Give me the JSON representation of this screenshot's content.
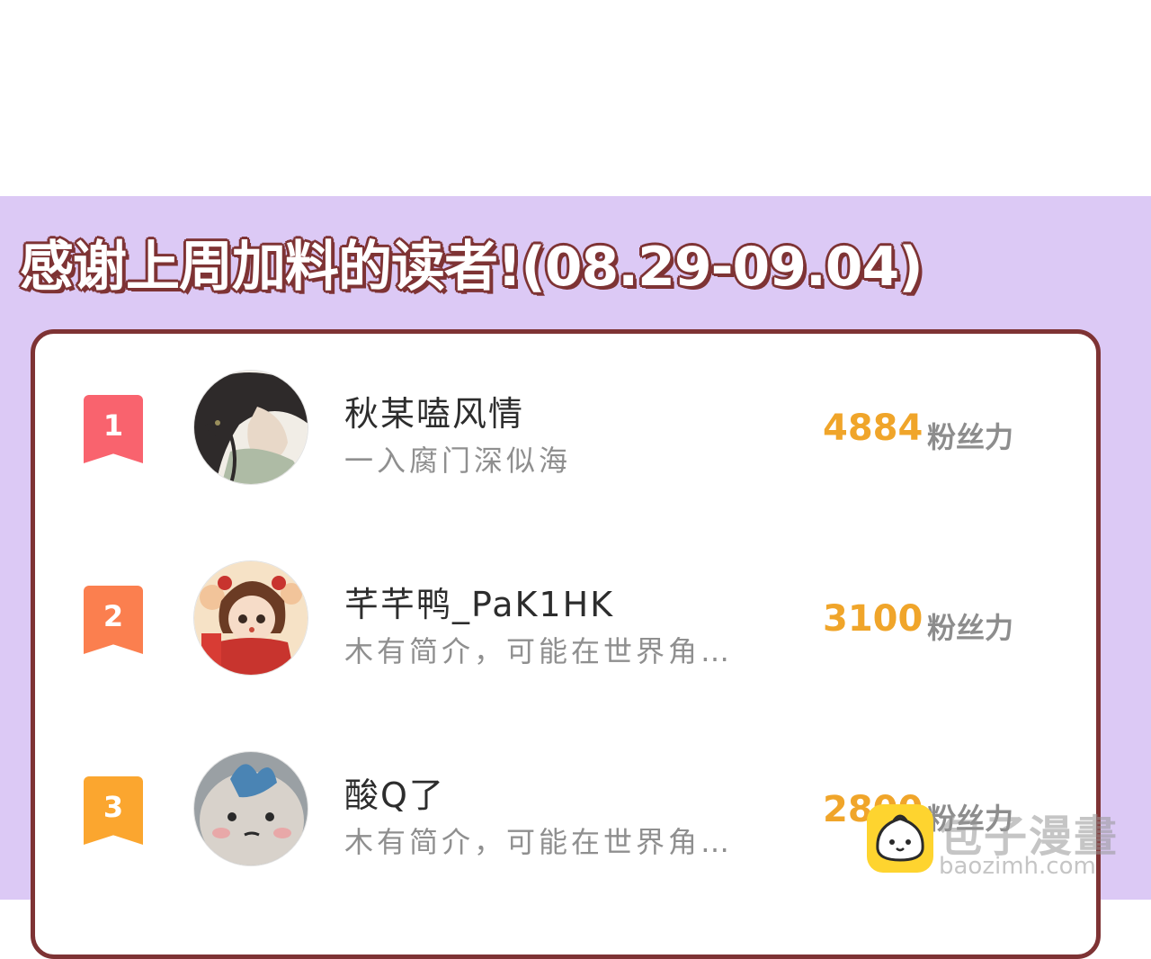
{
  "header": {
    "title": "感谢上周加料的读者!(08.29-09.04)"
  },
  "leaderboard": [
    {
      "rank": "1",
      "name": "秋某嗑风情",
      "bio": "一入腐门深似海",
      "score": "4884",
      "unit": "粉丝力",
      "badge_color": "#f9636e"
    },
    {
      "rank": "2",
      "name": "芊芊鸭_PaK1HK",
      "bio": "木有简介，可能在世界角…",
      "score": "3100",
      "unit": "粉丝力",
      "badge_color": "#fb7f4f"
    },
    {
      "rank": "3",
      "name": "酸Q了",
      "bio": "木有简介，可能在世界角…",
      "score": "2800",
      "unit": "粉丝力",
      "badge_color": "#fba62f"
    }
  ],
  "watermark": {
    "title": "包子漫畫",
    "url": "baozimh.com"
  },
  "colors": {
    "panel_background": "#dcc9f5",
    "border": "#7e3334",
    "score": "#f0a52a"
  }
}
